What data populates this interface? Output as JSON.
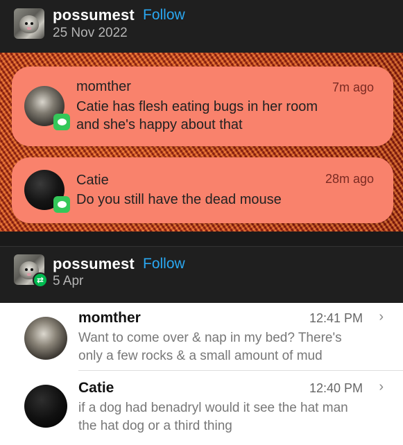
{
  "posts": [
    {
      "username": "possumest",
      "follow_label": "Follow",
      "date": "25 Nov 2022"
    },
    {
      "username": "possumest",
      "follow_label": "Follow",
      "date": "5 Apr"
    }
  ],
  "notifications": [
    {
      "sender": "momther",
      "time": "7m ago",
      "lines": [
        "Catie has flesh eating bugs in her room",
        "and she's happy about that"
      ]
    },
    {
      "sender": "Catie",
      "time": "28m ago",
      "lines": [
        "Do you still have the dead mouse"
      ]
    }
  ],
  "messages": [
    {
      "sender": "momther",
      "time": "12:41 PM",
      "chevron": "›",
      "lines": [
        "Want to come over & nap in my bed? There's",
        "only a few rocks & a small amount of mud"
      ]
    },
    {
      "sender": "Catie",
      "time": "12:40 PM",
      "chevron": "›",
      "lines": [
        "if a dog had benadryl would it see the hat man",
        "the hat dog or a third thing"
      ]
    }
  ],
  "icons": {
    "reblog": "⇄",
    "message_app": "messages-icon"
  },
  "colors": {
    "follow": "#2aa8f2",
    "notification_bg": "#f9826c",
    "messages_green": "#34c759",
    "reblog_green": "#00b94f"
  }
}
